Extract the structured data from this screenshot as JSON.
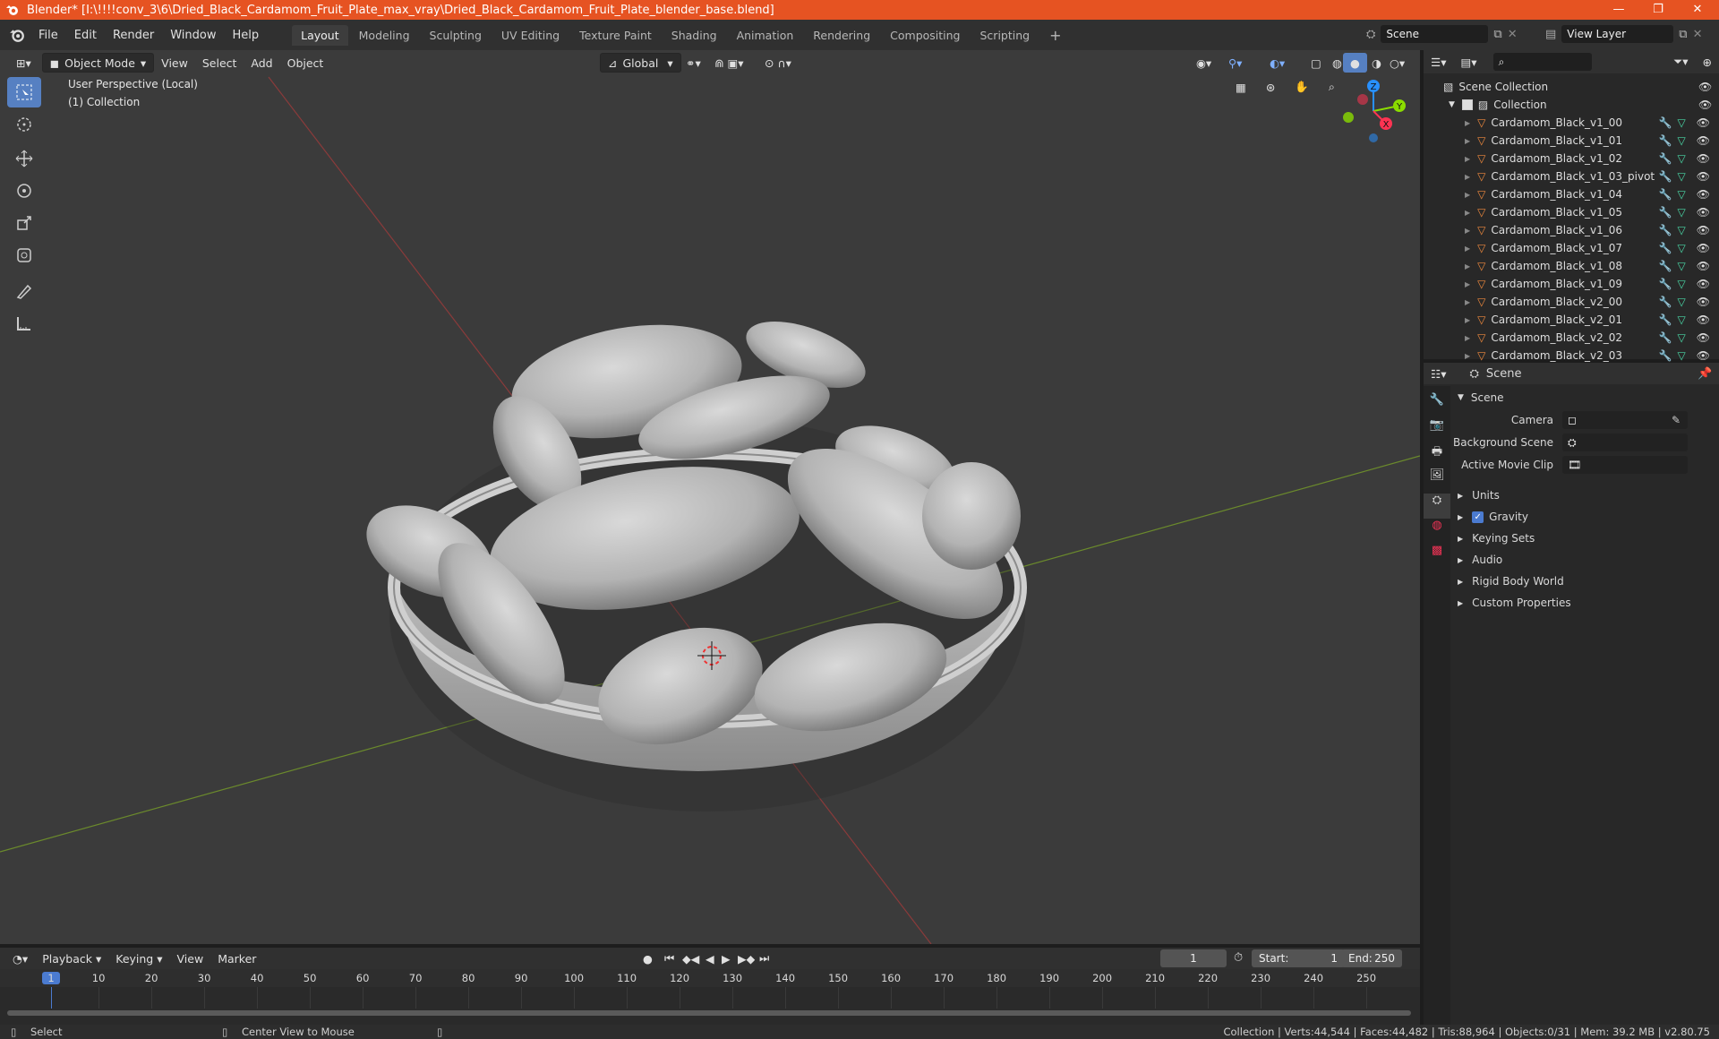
{
  "window": {
    "title": "Blender* [I:\\!!!!conv_3\\6\\Dried_Black_Cardamom_Fruit_Plate_max_vray\\Dried_Black_Cardamom_Fruit_Plate_blender_base.blend]",
    "minimize": "—",
    "maximize": "❐",
    "close": "✕"
  },
  "menu": [
    "File",
    "Edit",
    "Render",
    "Window",
    "Help"
  ],
  "workspaces": [
    "Layout",
    "Modeling",
    "Sculpting",
    "UV Editing",
    "Texture Paint",
    "Shading",
    "Animation",
    "Rendering",
    "Compositing",
    "Scripting"
  ],
  "active_workspace": "Layout",
  "scene_selector": {
    "value": "Scene"
  },
  "viewlayer_selector": {
    "value": "View Layer"
  },
  "viewport": {
    "mode": "Object Mode",
    "menus": [
      "View",
      "Select",
      "Add",
      "Object"
    ],
    "orientation": "Global",
    "info_line1": "User Perspective (Local)",
    "info_line2": "(1) Collection",
    "gizmo_axes": {
      "x": "X",
      "y": "Y",
      "z": "Z"
    }
  },
  "outliner": {
    "root": "Scene Collection",
    "collection": "Collection",
    "items": [
      "Cardamom_Black_v1_00",
      "Cardamom_Black_v1_01",
      "Cardamom_Black_v1_02",
      "Cardamom_Black_v1_03_pivot",
      "Cardamom_Black_v1_04",
      "Cardamom_Black_v1_05",
      "Cardamom_Black_v1_06",
      "Cardamom_Black_v1_07",
      "Cardamom_Black_v1_08",
      "Cardamom_Black_v1_09",
      "Cardamom_Black_v2_00",
      "Cardamom_Black_v2_01",
      "Cardamom_Black_v2_02",
      "Cardamom_Black_v2_03"
    ]
  },
  "properties": {
    "context": "Scene",
    "panel": "Scene",
    "fields": [
      {
        "label": "Camera"
      },
      {
        "label": "Background Scene"
      },
      {
        "label": "Active Movie Clip"
      }
    ],
    "sections": [
      "Units",
      "Gravity",
      "Keying Sets",
      "Audio",
      "Rigid Body World",
      "Custom Properties"
    ],
    "gravity_checked": true
  },
  "timeline": {
    "menus": [
      "Playback",
      "Keying",
      "View",
      "Marker"
    ],
    "current_frame": "1",
    "start_label": "Start:",
    "start": "1",
    "end_label": "End:",
    "end": "250",
    "ticks": [
      "1",
      "10",
      "20",
      "30",
      "40",
      "50",
      "60",
      "70",
      "80",
      "90",
      "100",
      "110",
      "120",
      "130",
      "140",
      "150",
      "160",
      "170",
      "180",
      "190",
      "200",
      "210",
      "220",
      "230",
      "240",
      "250"
    ]
  },
  "status": {
    "left_action": "Select",
    "mid_action": "Center View to Mouse",
    "right": "Collection | Verts:44,544 | Faces:44,482 | Tris:88,964 | Objects:0/31 | Mem: 39.2 MB | v2.80.75"
  },
  "colors": {
    "accent": "#e65322",
    "active_tool": "#5680c2",
    "x_axis": "#ff3352",
    "y_axis": "#8bdc00",
    "z_axis": "#2890ff"
  }
}
